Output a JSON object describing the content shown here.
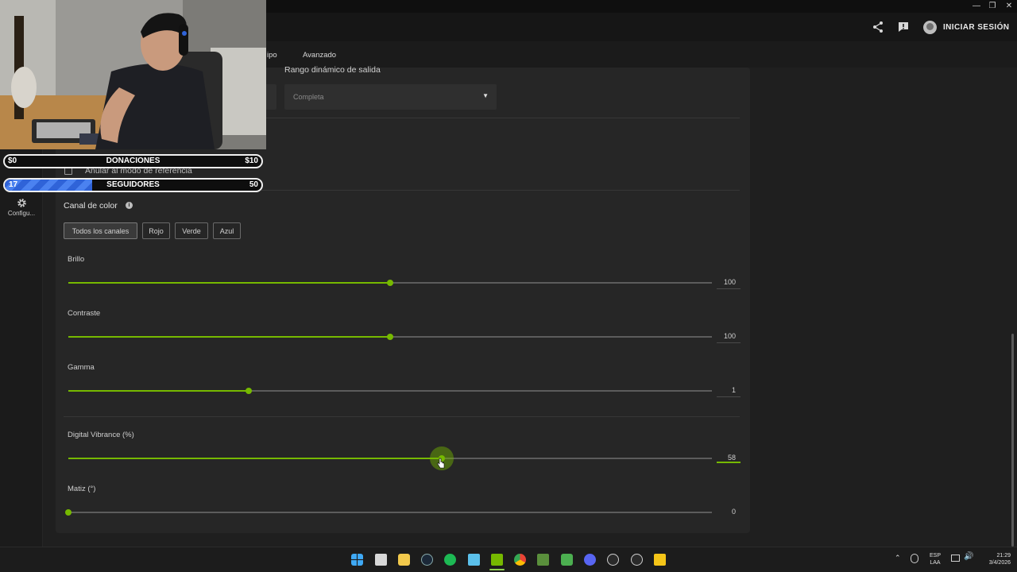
{
  "header": {
    "signin_label": "INICIAR SESIÓN",
    "share_icon": "share-icon",
    "feedback_icon": "feedback-icon"
  },
  "tabs": [
    {
      "label": "ipo"
    },
    {
      "label": "Avanzado"
    }
  ],
  "rail": {
    "config_label": "Configu..."
  },
  "output": {
    "dynamic_range_label": "Rango dinámico de salida",
    "dynamic_range_value": "Completa"
  },
  "override": {
    "label": "Anular al modo de referencia"
  },
  "color_channel": {
    "label": "Canal de color",
    "buttons": [
      "Todos los canales",
      "Rojo",
      "Verde",
      "Azul"
    ],
    "selected": "Todos los canales"
  },
  "sliders": [
    {
      "label": "Brillo",
      "value": "100",
      "fraction": 0.5
    },
    {
      "label": "Contraste",
      "value": "100",
      "fraction": 0.5
    },
    {
      "label": "Gamma",
      "value": "1",
      "fraction": 0.28
    },
    {
      "label": "Digital Vibrance (%)",
      "value": "58",
      "fraction": 0.58
    },
    {
      "label": "Matiz (°)",
      "value": "0",
      "fraction": 0.0
    }
  ],
  "stream_overlay": {
    "donations": {
      "label": "DONACIONES",
      "min": "$0",
      "max": "$10",
      "progress": 0
    },
    "followers": {
      "label": "SEGUIDORES",
      "current": "17",
      "max": "50",
      "progress": 0.34
    }
  },
  "taskbar": {
    "lang_top": "ESP",
    "lang_bottom": "LAA",
    "time": "21:29",
    "date": "3/4/2026"
  },
  "colors": {
    "accent": "#76b900",
    "panel": "#262626",
    "background": "#1f1f1f"
  }
}
